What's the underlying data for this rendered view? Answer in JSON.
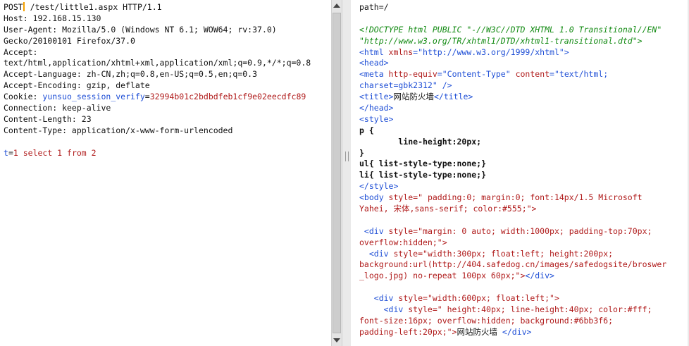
{
  "request": {
    "method": "POST",
    "path_line": " /test/little1.aspx HTTP/1.1",
    "headers": {
      "host": "Host: 192.168.15.130",
      "user_agent_1": "User-Agent: Mozilla/5.0 (Windows NT 6.1; WOW64; rv:37.0)",
      "user_agent_2": "Gecko/20100101 Firefox/37.0",
      "accept_1": "Accept:",
      "accept_2": "text/html,application/xhtml+xml,application/xml;q=0.9,*/*;q=0.8",
      "accept_language": "Accept-Language: zh-CN,zh;q=0.8,en-US;q=0.5,en;q=0.3",
      "accept_encoding": "Accept-Encoding: gzip, deflate",
      "cookie_label": "Cookie: ",
      "cookie_name": "yunsuo_session_verify",
      "cookie_eq": "=",
      "cookie_value": "32994b01c2bdbdfeb1cf9e02eecdfc89",
      "connection": "Connection: keep-alive",
      "content_length": "Content-Length: 23",
      "content_type": "Content-Type: application/x-www-form-urlencoded"
    },
    "body": {
      "param_name": "t",
      "eq": "=",
      "param_value": "1 select 1 from 2"
    }
  },
  "response": {
    "l01": "path=/",
    "l02": "<!DOCTYPE html PUBLIC \"-//W3C//DTD XHTML 1.0 Transitional//EN\"",
    "l03": "\"http://www.w3.org/TR/xhtml1/DTD/xhtml1-transitional.dtd\">",
    "l04_tag": "<html",
    "l04_attr": " xmlns",
    "l04_val": "=\"http://www.w3.org/1999/xhtml\">",
    "l05": "<head>",
    "l06_tag": "<meta",
    "l06_attr1": " http-equiv",
    "l06_val1": "=\"Content-Type\"",
    "l06_attr2": " content",
    "l06_val2": "=\"text/html;",
    "l07": "charset=gbk2312\" />",
    "l08_open": "<title>",
    "l08_text": "网站防火墙",
    "l08_close": "</title>",
    "l09": "</head>",
    "l10": "<style>",
    "l11": "p {",
    "l12": "        line-height:20px;",
    "l13": "}",
    "l14": "ul{ list-style-type:none;}",
    "l15": "li{ list-style-type:none;}",
    "l16": "</style>",
    "l17_tag": "<body",
    "l17_attr": " style",
    "l17_val": "=\" padding:0; margin:0; font:14px/1.5 Microsoft",
    "l18": "Yahei, 宋体,sans-serif; color:#555;\">",
    "l20_tag": " <div",
    "l20_attr": " style",
    "l20_val": "=\"margin: 0 auto; width:1000px; padding-top:70px;",
    "l21": "overflow:hidden;\">",
    "l22_tag": "  <div",
    "l22_attr": " style",
    "l22_val": "=\"width:300px; float:left; height:200px;",
    "l23": "background:url(http://404.safedog.cn/images/safedogsite/broswer",
    "l24_a": "_logo.jpg) no-repeat 100px 60px;\">",
    "l24_b": "</div>",
    "l26_tag": "   <div",
    "l26_attr": " style",
    "l26_val": "=\"width:600px; float:left;\">",
    "l27_tag": "     <div",
    "l27_attr": " style",
    "l27_val": "=\" height:40px; line-height:40px; color:#fff;",
    "l28": "font-size:16px; overflow:hidden; background:#6bb3f6;",
    "l29_a": "padding-left:20px;\">",
    "l29_b": "网站防火墙 ",
    "l29_c": "</div>"
  },
  "colors": {
    "tag": "#1f4fd6",
    "attr": "#b01b1b",
    "doctype": "#128a12",
    "cursor": "#f4a000"
  }
}
